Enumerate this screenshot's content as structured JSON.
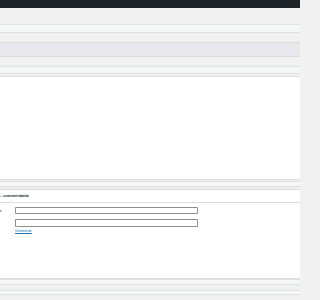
{
  "admin_bar": {},
  "section": {
    "title": "...commentable",
    "row1_label": "P",
    "row2_label": "",
    "field1_value": "",
    "field2_value": "",
    "link_label": "Schedule"
  }
}
